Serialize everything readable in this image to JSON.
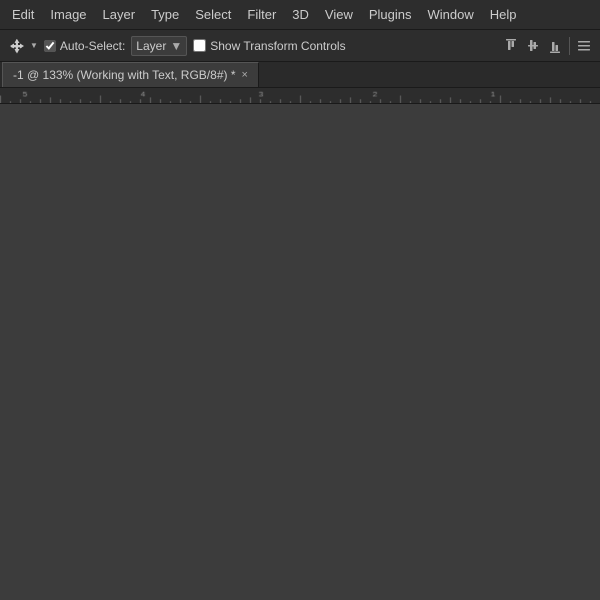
{
  "menubar": {
    "items": [
      "Edit",
      "Image",
      "Layer",
      "Type",
      "Select",
      "Filter",
      "3D",
      "View",
      "Plugins",
      "Window",
      "Help"
    ]
  },
  "optionsbar": {
    "auto_select_label": "Auto-Select:",
    "layer_value": "Layer",
    "show_transform_label": "Show Transform Controls",
    "auto_select_checked": true,
    "show_transform_checked": false
  },
  "tab": {
    "title": "-1 @ 133% (Working with Text, RGB/8#) *",
    "close_icon": "×"
  },
  "align_icons": [
    "align-left",
    "align-center",
    "align-right",
    "menu-lines"
  ],
  "canvas": {
    "background": "#3c3c3c"
  }
}
